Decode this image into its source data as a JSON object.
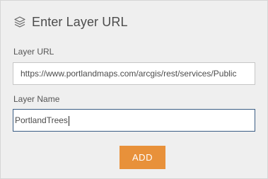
{
  "header": {
    "icon": "layers-icon",
    "title": "Enter Layer URL"
  },
  "form": {
    "url_label": "Layer URL",
    "url_value": "https://www.portlandmaps.com/arcgis/rest/services/Public",
    "name_label": "Layer Name",
    "name_value": "PortlandTrees"
  },
  "actions": {
    "add_label": "ADD"
  },
  "colors": {
    "accent": "#e8913a",
    "focus_border": "#3a5c84"
  }
}
